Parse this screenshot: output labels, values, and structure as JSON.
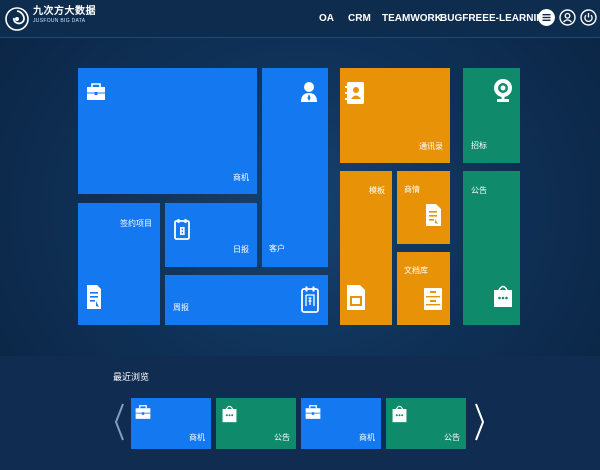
{
  "brand": {
    "name_cn": "九次方大数据",
    "name_en": "JUSFOUN BIG DATA"
  },
  "nav": [
    "OA",
    "CRM",
    "TEAMWORK",
    "BUGFREE",
    "E-LEARNING"
  ],
  "top_icons": [
    "menu-icon",
    "user-icon",
    "power-icon"
  ],
  "tiles": {
    "business_opportunity": "商机",
    "customer": "客户",
    "signed_project": "签约项目",
    "daily_report": "日报",
    "weekly_report": "周报",
    "address_book": "通讯录",
    "template": "模板",
    "business_status": "商情",
    "archive": "文档库",
    "bidding": "招标",
    "announcement": "公告"
  },
  "recent": {
    "title": "最近浏览",
    "items": [
      {
        "label": "商机",
        "color": "blue",
        "icon": "briefcase-icon"
      },
      {
        "label": "公告",
        "color": "green",
        "icon": "bag-icon"
      },
      {
        "label": "商机",
        "color": "blue",
        "icon": "briefcase-icon"
      },
      {
        "label": "公告",
        "color": "green",
        "icon": "bag-icon"
      }
    ]
  },
  "colors": {
    "blue": "#1478f0",
    "orange": "#e89307",
    "green": "#0f8b6b",
    "header": "#0d2c4e",
    "background": "#0f3157"
  }
}
